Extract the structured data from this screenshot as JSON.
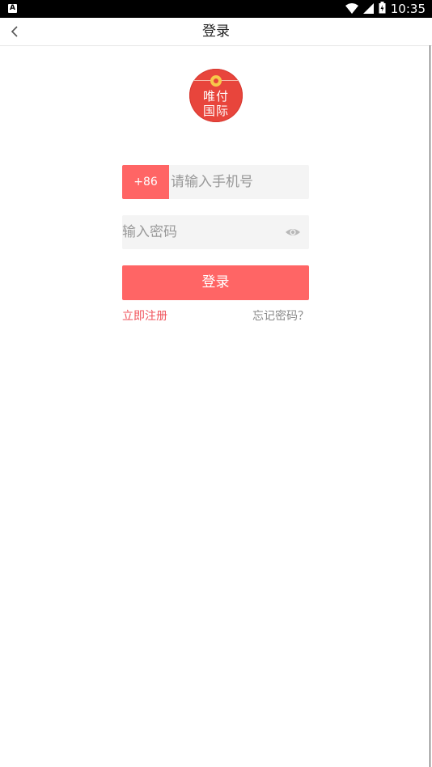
{
  "status_bar": {
    "left_badge": "A",
    "time": "10:35",
    "icons": [
      "wifi-icon",
      "signal-icon",
      "battery-icon"
    ]
  },
  "header": {
    "title": "登录",
    "back_icon": "chevron-left-icon"
  },
  "logo": {
    "line1": "唯付",
    "line2": "国际"
  },
  "form": {
    "country_code": "+86",
    "phone_placeholder": "请输入手机号",
    "phone_value": "",
    "password_placeholder": "输入密码",
    "password_value": "",
    "eye_icon": "eye-icon",
    "login_label": "登录"
  },
  "links": {
    "register": "立即注册",
    "forgot": "忘记密码？"
  },
  "colors": {
    "accent": "#ff6565",
    "register_link": "#f0525a",
    "forgot_link": "#888888",
    "field_bg": "#f4f4f4",
    "logo_red": "#e8453c",
    "logo_gold": "#f7c94a"
  }
}
